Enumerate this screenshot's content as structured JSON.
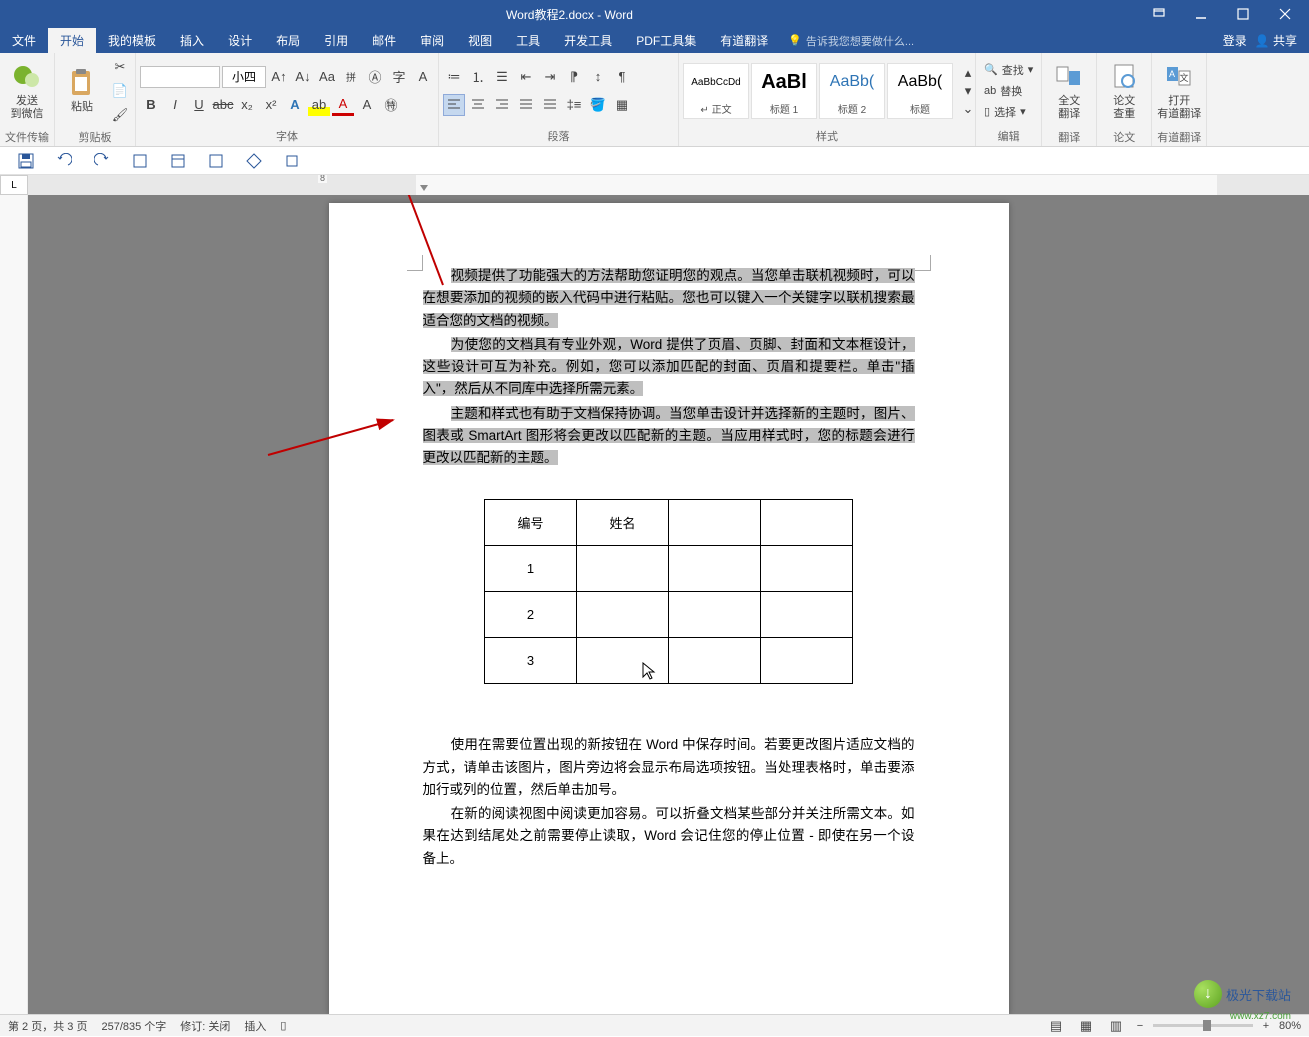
{
  "titlebar": {
    "title": "Word教程2.docx - Word"
  },
  "menu": {
    "items": [
      "文件",
      "开始",
      "我的模板",
      "插入",
      "设计",
      "布局",
      "引用",
      "邮件",
      "审阅",
      "视图",
      "工具",
      "开发工具",
      "PDF工具集",
      "有道翻译"
    ],
    "active_index": 1,
    "tell_me": "告诉我您想要做什么...",
    "login": "登录",
    "share": "共享"
  },
  "ribbon": {
    "group_send": {
      "label": "文件传输",
      "btn": "发送\n到微信"
    },
    "group_clipboard": {
      "label": "剪贴板",
      "paste": "粘贴"
    },
    "group_font": {
      "label": "字体",
      "font_name": "",
      "font_size": "小四"
    },
    "group_paragraph": {
      "label": "段落"
    },
    "group_styles": {
      "label": "样式",
      "items": [
        {
          "preview": "AaBbCcDd",
          "name": "↵ 正文"
        },
        {
          "preview": "AaBl",
          "name": "标题 1"
        },
        {
          "preview": "AaBb(",
          "name": "标题 2"
        },
        {
          "preview": "AaBb(",
          "name": "标题"
        }
      ]
    },
    "group_edit": {
      "label": "编辑",
      "find": "查找",
      "replace": "替换",
      "select": "选择"
    },
    "group_fulltext": {
      "label": "翻译",
      "btn": "全文\n翻译"
    },
    "group_thesis": {
      "label": "论文",
      "btn": "论文\n查重"
    },
    "group_youdao": {
      "label": "有道翻译",
      "btn": "打开\n有道翻译"
    }
  },
  "doc": {
    "p1": "视频提供了功能强大的方法帮助您证明您的观点。当您单击联机视频时，可以在想要添加的视频的嵌入代码中进行粘贴。您也可以键入一个关键字以联机搜索最适合您的文档的视频。",
    "p2": "为使您的文档具有专业外观，Word 提供了页眉、页脚、封面和文本框设计，这些设计可互为补充。例如，您可以添加匹配的封面、页眉和提要栏。单击\"插入\"，然后从不同库中选择所需元素。",
    "p3": "主题和样式也有助于文档保持协调。当您单击设计并选择新的主题时，图片、图表或 SmartArt 图形将会更改以匹配新的主题。当应用样式时，您的标题会进行更改以匹配新的主题。",
    "p4": "使用在需要位置出现的新按钮在 Word 中保存时间。若要更改图片适应文档的方式，请单击该图片，图片旁边将会显示布局选项按钮。当处理表格时，单击要添加行或列的位置，然后单击加号。",
    "p5": "在新的阅读视图中阅读更加容易。可以折叠文档某些部分并关注所需文本。如果在达到结尾处之前需要停止读取，Word 会记住您的停止位置 - 即使在另一个设备上。",
    "table": {
      "headers": [
        "编号",
        "姓名",
        "",
        ""
      ],
      "rows": [
        [
          "1",
          "",
          "",
          ""
        ],
        [
          "2",
          "",
          "",
          ""
        ],
        [
          "3",
          "",
          "",
          ""
        ]
      ]
    }
  },
  "status": {
    "page": "第 2 页，共 3 页",
    "words": "257/835 个字",
    "rev": "修订: 关闭",
    "insert": "插入",
    "zoom": "80%"
  },
  "watermark": {
    "name": "极光下载站",
    "url": "www.xz7.com"
  }
}
